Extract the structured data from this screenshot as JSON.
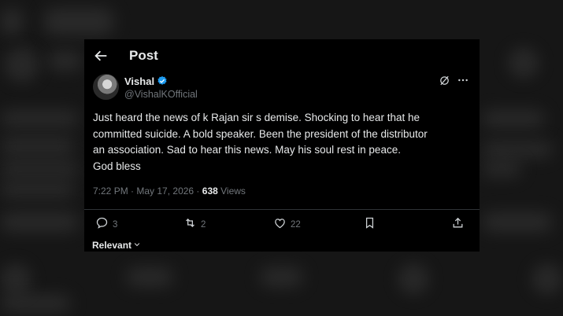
{
  "header": {
    "title": "Post"
  },
  "author": {
    "name": "Vishal",
    "handle": "@VishalKOfficial"
  },
  "tweet": {
    "text": "Just heard the news of k Rajan sir s demise.  Shocking to hear that he\ncommitted suicide.  A bold speaker. Been the president of the distributor\nan association.   Sad to hear this news. May his soul rest in peace.\nGod  bless"
  },
  "meta": {
    "time": "7:22 PM",
    "separator": " · ",
    "date": "May 17, 2026",
    "views_count": "638",
    "views_label": " Views"
  },
  "actions": {
    "replies": "3",
    "reposts": "2",
    "likes": "22"
  },
  "footer": {
    "sort_label": "Relevant"
  },
  "colors": {
    "accent": "#1d9bf0",
    "muted": "#71767b",
    "text": "#e7e9ea",
    "card_bg": "#000000"
  },
  "icons": [
    "back-arrow-icon",
    "verified-badge-icon",
    "grok-icon",
    "more-icon",
    "reply-icon",
    "repost-icon",
    "like-icon",
    "bookmark-icon",
    "share-icon",
    "chevron-down-icon"
  ]
}
